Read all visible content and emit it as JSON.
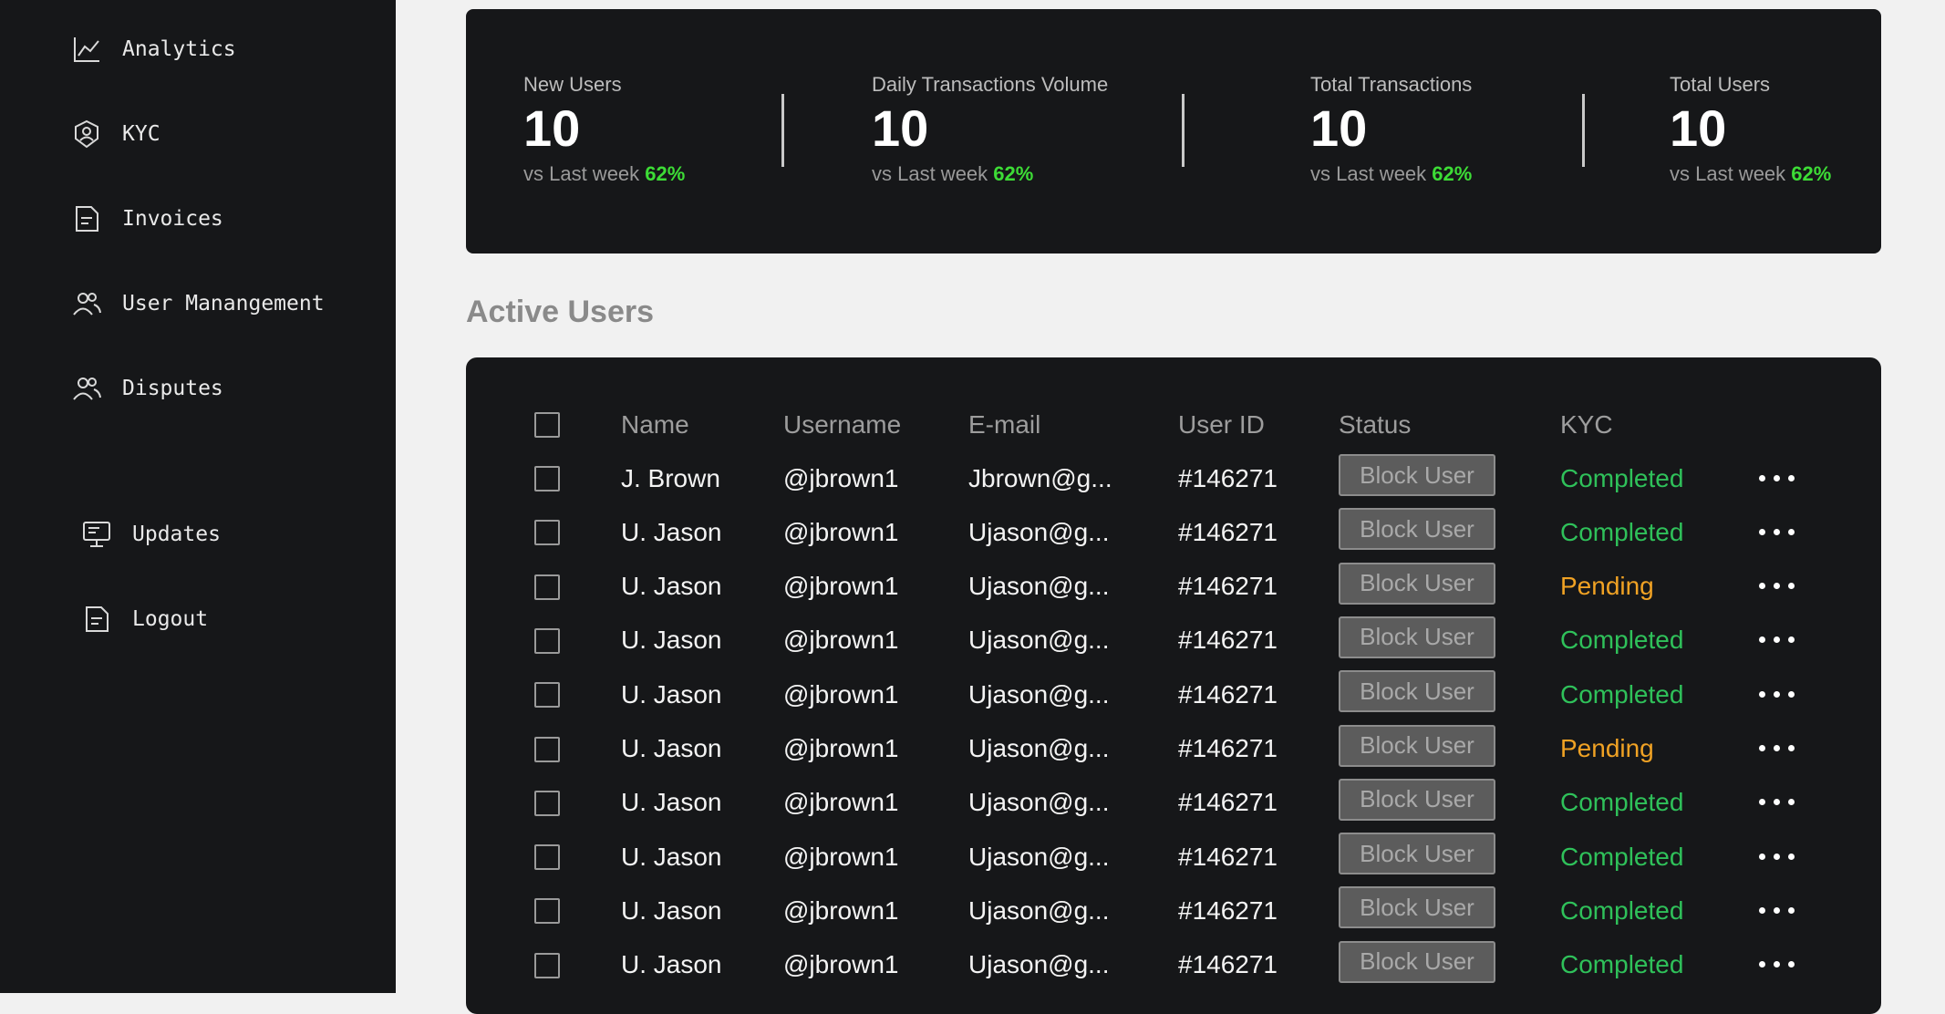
{
  "sidebar": {
    "items": [
      {
        "label": "Analytics",
        "icon": "chart-line-icon"
      },
      {
        "label": "KYC",
        "icon": "id-badge-icon"
      },
      {
        "label": "Invoices",
        "icon": "document-icon"
      },
      {
        "label": "User Manangement",
        "icon": "users-icon"
      },
      {
        "label": "Disputes",
        "icon": "users-icon"
      },
      {
        "label": "Updates",
        "icon": "monitor-icon"
      },
      {
        "label": "Logout",
        "icon": "document-icon"
      }
    ]
  },
  "stats": [
    {
      "label": "New Users",
      "value": "10",
      "compare": "vs Last week",
      "pct": "62%"
    },
    {
      "label": "Daily Transactions Volume",
      "value": "10",
      "compare": "vs Last week",
      "pct": "62%"
    },
    {
      "label": "Total Transactions",
      "value": "10",
      "compare": "vs Last week",
      "pct": "62%"
    },
    {
      "label": "Total Users",
      "value": "10",
      "compare": "vs Last week",
      "pct": "62%"
    }
  ],
  "active_users": {
    "title": "Active Users",
    "columns": [
      "Name",
      "Username",
      "E-mail",
      "User ID",
      "Status",
      "KYC"
    ],
    "block_label": "Block User",
    "rows": [
      {
        "name": "J. Brown",
        "username": "@jbrown1",
        "email": "Jbrown@g...",
        "user_id": "#146271",
        "kyc": "Completed"
      },
      {
        "name": "U. Jason",
        "username": "@jbrown1",
        "email": "Ujason@g...",
        "user_id": "#146271",
        "kyc": "Completed"
      },
      {
        "name": "U. Jason",
        "username": "@jbrown1",
        "email": "Ujason@g...",
        "user_id": "#146271",
        "kyc": "Pending"
      },
      {
        "name": "U. Jason",
        "username": "@jbrown1",
        "email": "Ujason@g...",
        "user_id": "#146271",
        "kyc": "Completed"
      },
      {
        "name": "U. Jason",
        "username": "@jbrown1",
        "email": "Ujason@g...",
        "user_id": "#146271",
        "kyc": "Completed"
      },
      {
        "name": "U. Jason",
        "username": "@jbrown1",
        "email": "Ujason@g...",
        "user_id": "#146271",
        "kyc": "Pending"
      },
      {
        "name": "U. Jason",
        "username": "@jbrown1",
        "email": "Ujason@g...",
        "user_id": "#146271",
        "kyc": "Completed"
      },
      {
        "name": "U. Jason",
        "username": "@jbrown1",
        "email": "Ujason@g...",
        "user_id": "#146271",
        "kyc": "Completed"
      },
      {
        "name": "U. Jason",
        "username": "@jbrown1",
        "email": "Ujason@g...",
        "user_id": "#146271",
        "kyc": "Completed"
      },
      {
        "name": "U. Jason",
        "username": "@jbrown1",
        "email": "Ujason@g...",
        "user_id": "#146271",
        "kyc": "Completed"
      }
    ]
  },
  "colors": {
    "sidebar_bg": "#161719",
    "page_bg": "#f1f1f1",
    "positive": "#3ddc36",
    "kyc_completed": "#2fc15a",
    "kyc_pending": "#f0a224"
  }
}
